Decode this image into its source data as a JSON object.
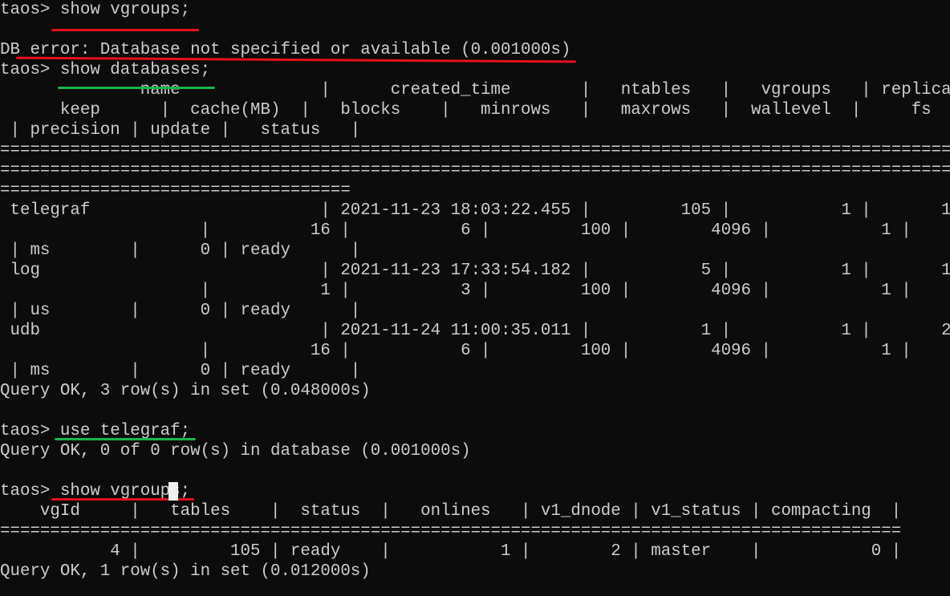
{
  "terminal": {
    "lines": [
      "taos> show vgroups;",
      "",
      "DB error: Database not specified or available (0.001000s)",
      "taos> show databases;",
      "              name              |      created_time       |   ntables   |   vgroups   | replica",
      "      keep      |  cache(MB)  |   blocks    |   minrows   |   maxrows   |  wallevel  |     fs",
      " | precision | update |   status   |",
      "=========================================================================================================",
      "=========================================================================================================",
      "===================================",
      " telegraf                       | 2021-11-23 18:03:22.455 |         105 |           1 |       1",
      "                    |          16 |           6 |         100 |        4096 |           1 |",
      " | ms        |      0 | ready      |",
      " log                            | 2021-11-23 17:33:54.182 |           5 |           1 |       1",
      "                    |           1 |           3 |         100 |        4096 |           1 |",
      " | us        |      0 | ready      |",
      " udb                            | 2021-11-24 11:00:35.011 |           1 |           1 |       2",
      "                    |          16 |           6 |         100 |        4096 |           1 |",
      " | ms        |      0 | ready      |",
      "Query OK, 3 row(s) in set (0.048000s)",
      "",
      "taos> use telegraf;",
      "Query OK, 0 of 0 row(s) in database (0.001000s)",
      "",
      "taos> show vgroups;",
      "    vgId     |   tables    |  status  |   onlines   | v1_dnode | v1_status | compacting  |",
      "==========================================================================================",
      "           4 |         105 | ready    |           1 |        2 | master    |           0 |",
      "Query OK, 1 row(s) in set (0.012000s)"
    ]
  },
  "annotations": {
    "red_color": "#e8101c",
    "green_color": "#19b34a"
  }
}
